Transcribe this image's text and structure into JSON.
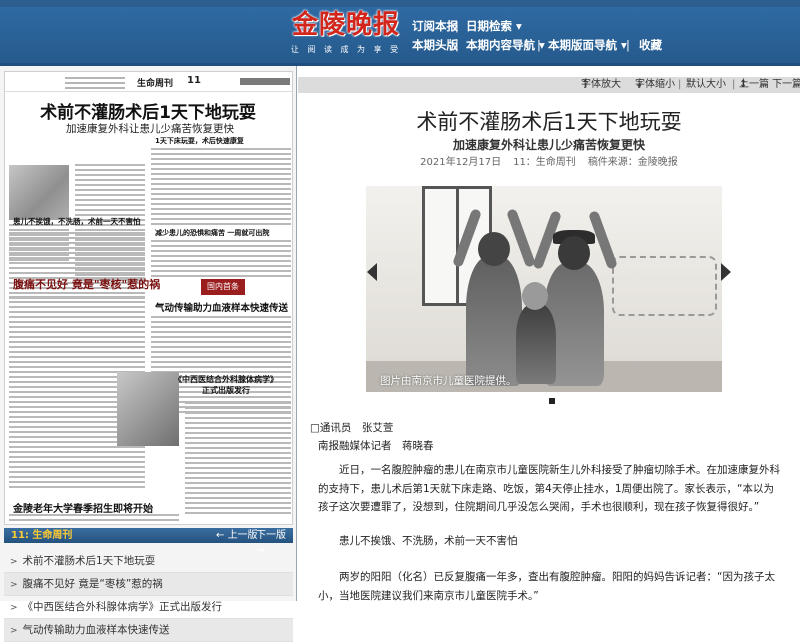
{
  "header": {
    "logo_title": "金陵晚报",
    "logo_slogan": "让 阅 读 成 为 享 受",
    "nav_row1": [
      {
        "label": "订阅本报"
      },
      {
        "label": "日期检索 ▾"
      }
    ],
    "nav_row2": [
      {
        "label": "本期头版"
      },
      {
        "label": "本期内容导航 ▾"
      },
      {
        "label": "本期版面导航 ▾"
      },
      {
        "label": "收藏"
      }
    ]
  },
  "paper_page": {
    "section": "生命周刊",
    "page_no": "11",
    "headline": "术前不灌肠术后1天下地玩耍",
    "subhead": "加速康复外科让患儿少痛苦恢复更快",
    "h_bold1": "患儿不挨饿，不洗肠，术前一天不害怕",
    "h_right1": "1天下床玩耍，术后快速康复",
    "h_right2": "减少患儿的恐惧和痛苦 一周就可出院",
    "h_mid": "腹痛不见好 竟是\"枣核\"惹的祸",
    "h_gas": "气动传输助力血液样本快速传送",
    "h_book": "《中西医结合外科腺体病学》正式出版发行",
    "h_bottom": "金陵老年大学春季招生即将开始",
    "banner": "国内首条",
    "bar_title": "11: 生命周刊",
    "bar_prev": "上一版",
    "bar_next": "下一版"
  },
  "article_list": [
    {
      "label": "术前不灌肠术后1天下地玩耍"
    },
    {
      "label": "腹痛不见好 竟是“枣核”惹的祸"
    },
    {
      "label": "《中西医结合外科腺体病学》正式出版发行"
    },
    {
      "label": "气动传输助力血液样本快速传送"
    }
  ],
  "toolbar": {
    "font_size": "字体放大",
    "font_small": "字体缩小",
    "default_size": "默认大小",
    "prev_next": "上一篇 下一篇",
    "arrow_up": "↑",
    "arrow_down": "↓",
    "arrow_up2": "↑",
    "arrow_down2": "↓"
  },
  "article": {
    "title": "术前不灌肠术后1天下地玩耍",
    "subtitle": "加速康复外科让患儿少痛苦恢复更快",
    "meta_date": "2021年12月17日",
    "meta_page": "11：生命周刊",
    "meta_source": "稿件来源：金陵晚报",
    "photo_caption": "图片由南京市儿童医院提供。",
    "byline1": "□通讯员　张艾萱",
    "byline2": "南报融媒体记者　蒋晓春",
    "para1": "近日，一名腹腔肿瘤的患儿在南京市儿童医院新生儿外科接受了肿瘤切除手术。在加速康复外科的支持下，患儿术后第1天就下床走路、吃饭，第4天停止挂水，1周便出院了。家长表示，“本以为孩子这次要遭罪了，没想到，住院期间几乎没怎么哭闹，手术也很顺利，现在孩子恢复得很好。”",
    "para2": "患儿不挨饿、不洗肠，术前一天不害怕",
    "para3": "两岁的阳阳（化名）已反复腹痛一年多，查出有腹腔肿瘤。阳阳的妈妈告诉记者：“因为孩子太小，当地医院建议我们来南京市儿童医院手术。”"
  }
}
